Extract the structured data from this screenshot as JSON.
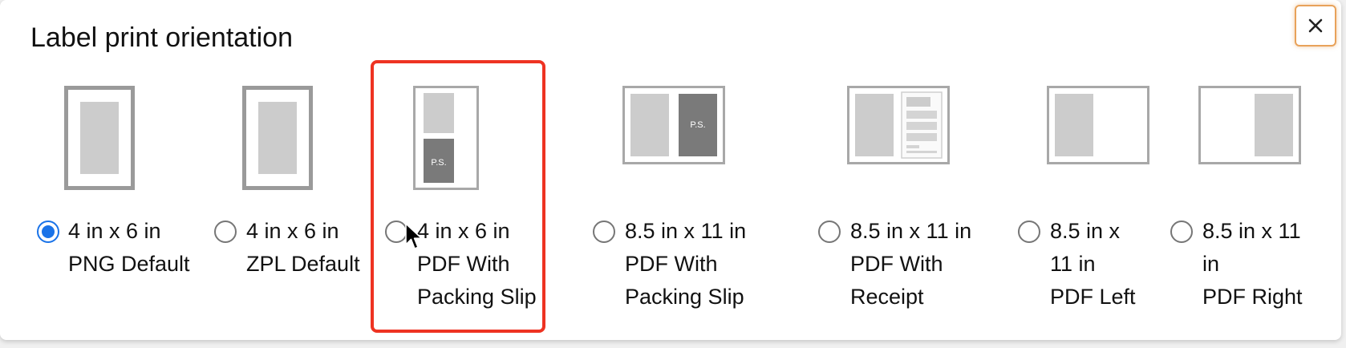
{
  "dialog": {
    "title": "Label print orientation",
    "close_icon": "close-icon"
  },
  "options": [
    {
      "id": "png-default",
      "lines": [
        "4 in x 6 in",
        "PNG Default"
      ],
      "selected": true,
      "icon": "label-portrait-icon"
    },
    {
      "id": "zpl-default",
      "lines": [
        "4 in x 6 in",
        "ZPL Default"
      ],
      "selected": false,
      "icon": "label-portrait-icon"
    },
    {
      "id": "pdf-packing-slip-4x6",
      "lines": [
        "4 in x 6 in",
        "PDF With",
        "Packing Slip"
      ],
      "selected": false,
      "icon": "label-with-packing-slip-icon",
      "thumb_text": "P.S."
    },
    {
      "id": "pdf-packing-slip-8x11",
      "lines": [
        "8.5 in x 11 in",
        "PDF With",
        "Packing Slip"
      ],
      "selected": false,
      "icon": "sheet-with-packing-slip-icon",
      "thumb_text": "P.S."
    },
    {
      "id": "pdf-receipt",
      "lines": [
        "8.5 in x 11 in",
        "PDF With",
        "Receipt"
      ],
      "selected": false,
      "icon": "sheet-with-receipt-icon"
    },
    {
      "id": "pdf-left",
      "lines": [
        "8.5 in x",
        "11 in",
        "PDF Left"
      ],
      "selected": false,
      "icon": "sheet-label-left-icon"
    },
    {
      "id": "pdf-right",
      "lines": [
        "8.5 in x 11",
        "in",
        "PDF Right"
      ],
      "selected": false,
      "icon": "sheet-label-right-icon"
    }
  ],
  "colors": {
    "accent": "#1a73e8",
    "highlight": "#ee3322",
    "close_border": "#e8a25a"
  }
}
